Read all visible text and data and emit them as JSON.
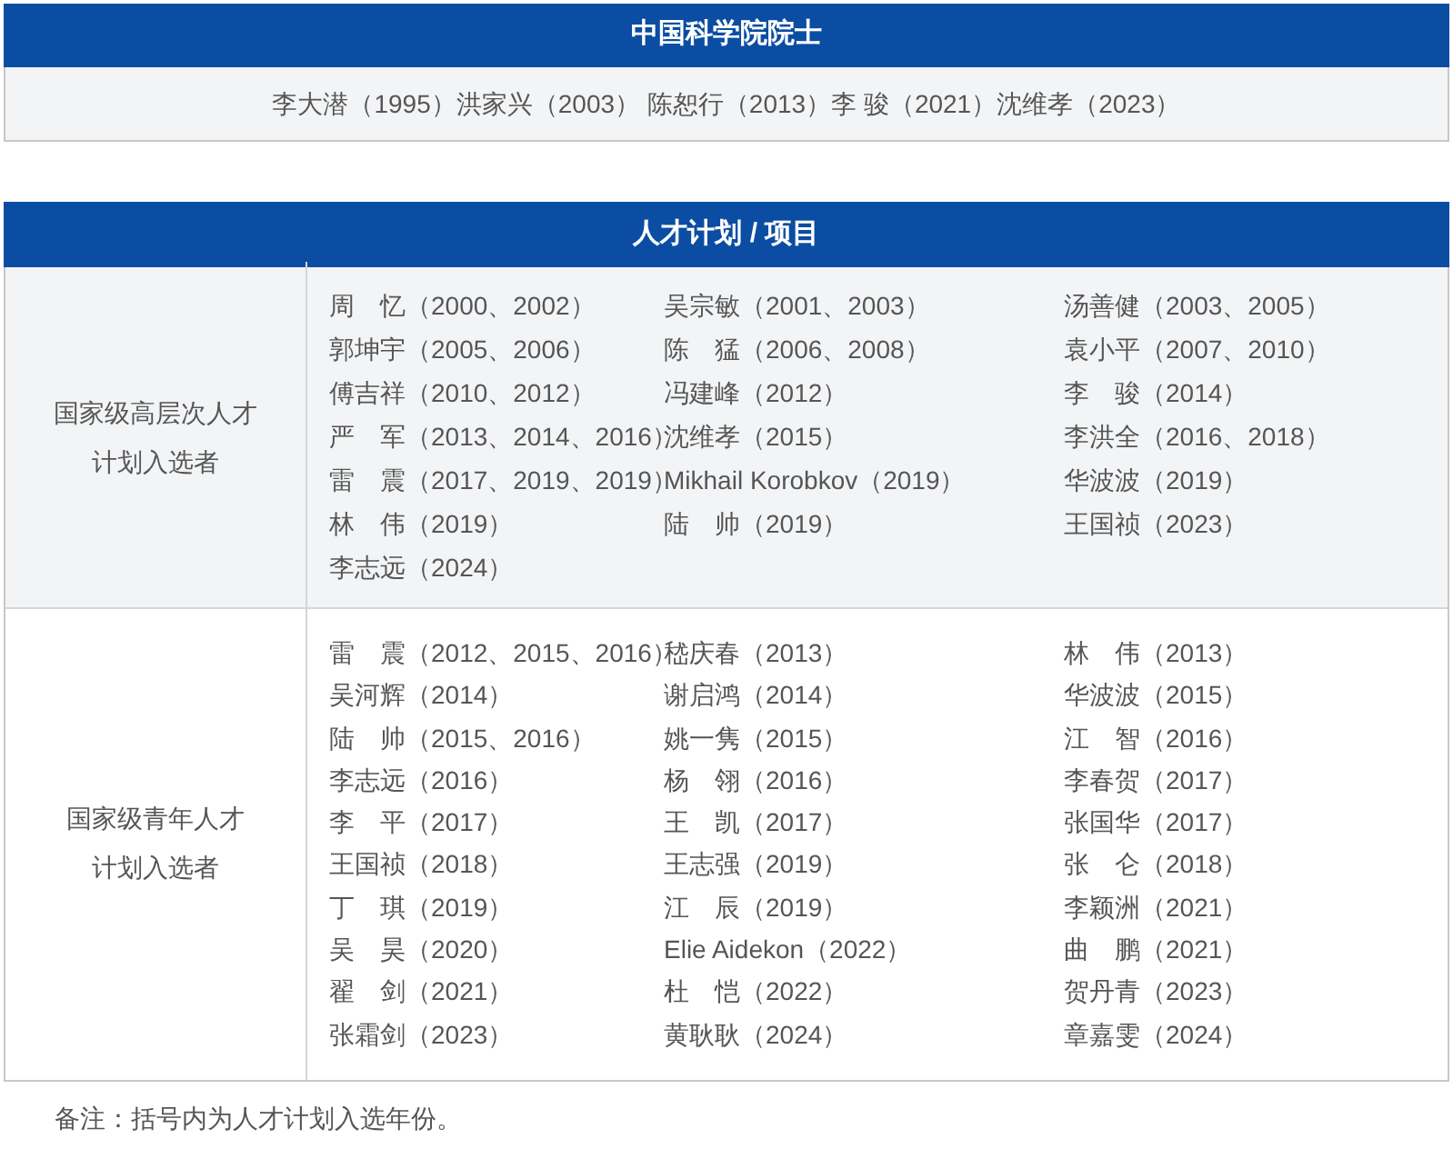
{
  "academicians": {
    "title": "中国科学院院士",
    "text": "李大潜（1995）洪家兴（2003） 陈恕行（2013）李 骏（2021）沈维孝（2023）"
  },
  "talent": {
    "title": "人才计划 / 项目",
    "sections": [
      {
        "label_lines": [
          "国家级高层次人才",
          "计划入选者"
        ],
        "shaded": true,
        "columns": [
          [
            "周　忆（2000、2002）",
            "郭坤宇（2005、2006）",
            "傅吉祥（2010、2012）",
            "严　军（2013、2014、2016）",
            "雷　震（2017、2019、2019）",
            "林　伟（2019）",
            "李志远（2024）"
          ],
          [
            "吴宗敏（2001、2003）",
            "陈　猛（2006、2008）",
            "冯建峰（2012）",
            "沈维孝（2015）",
            "Mikhail Korobkov（2019）",
            "陆　帅（2019）"
          ],
          [
            "汤善健（2003、2005）",
            "袁小平（2007、2010）",
            "李　骏（2014）",
            "李洪全（2016、2018）",
            "华波波（2019）",
            "王国祯（2023）"
          ]
        ]
      },
      {
        "label_lines": [
          "国家级青年人才",
          "计划入选者"
        ],
        "shaded": false,
        "columns": [
          [
            "雷　震（2012、2015、2016）",
            "吴河辉（2014）",
            "陆　帅（2015、2016）",
            "李志远（2016）",
            "李　平（2017）",
            "王国祯（2018）",
            "丁　琪（2019）",
            "吴　昊（2020）",
            "翟　剑（2021）",
            "张霜剑（2023）"
          ],
          [
            "嵇庆春（2013）",
            "谢启鸿（2014）",
            "姚一隽（2015）",
            "杨　翎（2016）",
            "王　凯（2017）",
            "王志强（2019）",
            "江　辰（2019）",
            "Elie Aidekon（2022）",
            "杜　恺（2022）",
            "黄耿耿（2024）"
          ],
          [
            "林　伟（2013）",
            "华波波（2015）",
            "江　智（2016）",
            "李春贺（2017）",
            "张国华（2017）",
            "张　仑（2018）",
            "李颖洲（2021）",
            "曲　鹏（2021）",
            "贺丹青（2023）",
            "章嘉雯（2024）"
          ]
        ]
      }
    ]
  },
  "note": "备注：括号内为人才计划入选年份。"
}
